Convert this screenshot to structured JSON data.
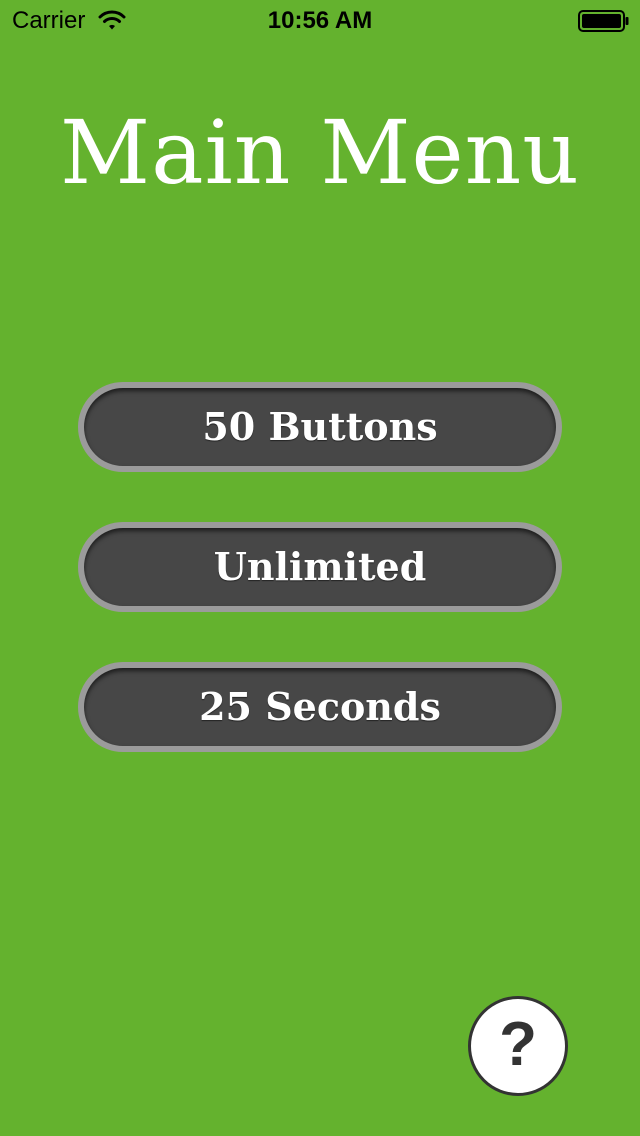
{
  "status_bar": {
    "carrier": "Carrier",
    "time": "10:56 AM"
  },
  "title": "Main Menu",
  "menu": {
    "buttons": [
      {
        "label": "50 Buttons"
      },
      {
        "label": "Unlimited"
      },
      {
        "label": "25 Seconds"
      }
    ]
  },
  "help": {
    "label": "?"
  },
  "colors": {
    "background": "#64b22e",
    "button_fill": "#474747",
    "button_border": "#9b9b9b",
    "text": "#ffffff"
  },
  "icons": [
    "wifi-icon",
    "battery-icon",
    "help-icon"
  ]
}
